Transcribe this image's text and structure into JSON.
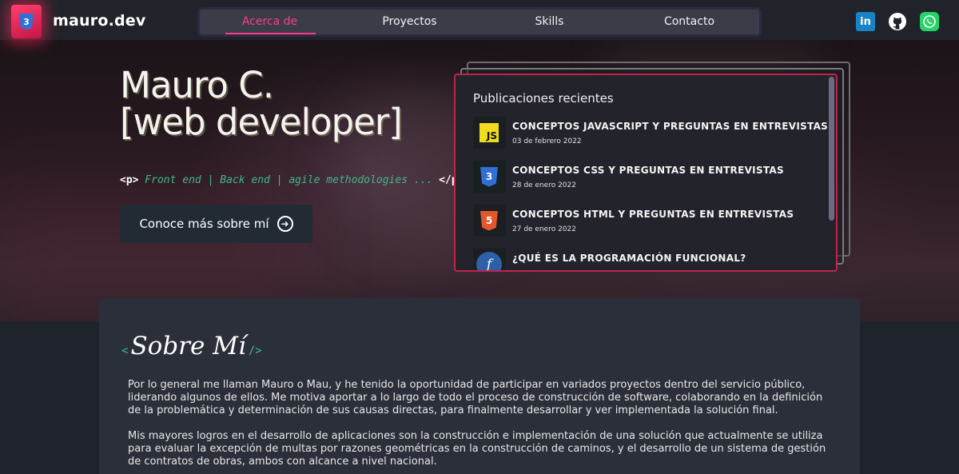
{
  "navbar": {
    "brand": "mauro.dev",
    "logo_icon": "css3-icon",
    "menu": [
      "Acerca de",
      "Proyectos",
      "Skills",
      "Contacto"
    ],
    "active_index": 0,
    "social": [
      "linkedin-icon",
      "github-icon",
      "whatsapp-icon"
    ]
  },
  "hero": {
    "title_line1": "Mauro C.",
    "title_line2": "[web developer]",
    "code_open": "<p>",
    "code_text": " Front end | Back end | agile methodologies ... ",
    "code_close": "</p>",
    "cta_label": "Conoce más sobre mí"
  },
  "posts": {
    "title": "Publicaciones recientes",
    "items": [
      {
        "title": "CONCEPTOS JAVASCRIPT Y PREGUNTAS EN ENTREVISTAS",
        "date": "03 de febrero 2022",
        "icon": "js-icon",
        "icon_text": "JS"
      },
      {
        "title": "CONCEPTOS CSS Y PREGUNTAS EN ENTREVISTAS",
        "date": "28 de enero 2022",
        "icon": "css3-icon",
        "icon_text": "3"
      },
      {
        "title": "CONCEPTOS HTML Y PREGUNTAS EN ENTREVISTAS",
        "date": "27 de enero 2022",
        "icon": "html5-icon",
        "icon_text": "5"
      },
      {
        "title": "¿QUÉ ES LA PROGRAMACIÓN FUNCIONAL?",
        "date": "",
        "icon": "function-icon",
        "icon_text": "f"
      }
    ]
  },
  "about": {
    "open_bracket": "<",
    "heading": "Sobre Mí",
    "close_bracket": "/>",
    "paragraph1": "Por lo general me llaman Mauro o Mau, y he tenido la oportunidad de participar en variados proyectos dentro del servicio público, liderando algunos de ellos. Me motiva aportar a lo largo de todo el proceso de construcción de software, colaborando en la definición de la problemática y determinación de sus causas directas, para finalmente desarrollar y ver implementada la solución final.",
    "paragraph2": "Mis mayores logros en el desarrollo de aplicaciones son la construcción e implementación de una solución que actualmente se utiliza para evaluar la excepción de multas por razones geométricas en la construcción de caminos, y el desarrollo de un sistema de gestión de contratos de obras, ambos con alcance a nivel nacional."
  },
  "colors": {
    "accent": "#ff3d7f",
    "panel_border": "#c0234f",
    "code_green": "#3fb88a",
    "background": "#1e2229"
  }
}
